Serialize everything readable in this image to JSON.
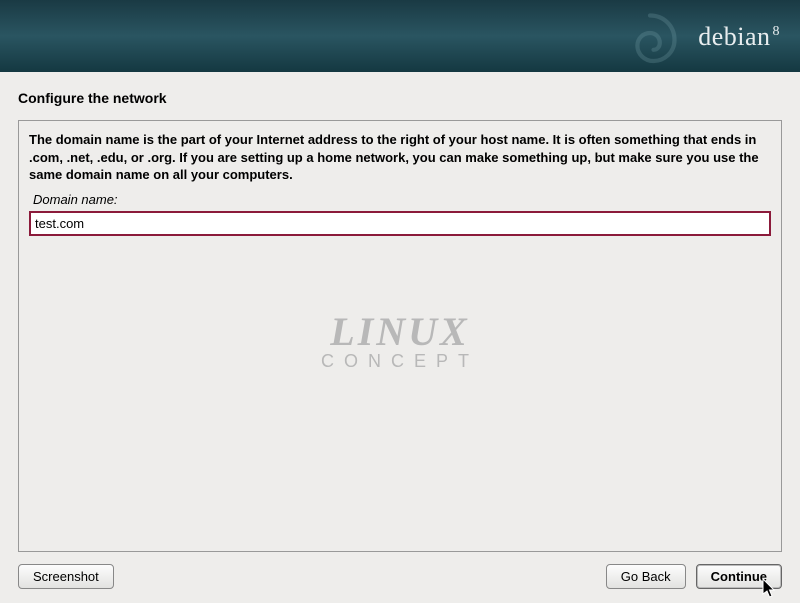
{
  "banner": {
    "brand": "debian",
    "version": "8"
  },
  "page": {
    "title": "Configure the network",
    "instructions": "The domain name is the part of your Internet address to the right of your host name.  It is often something that ends in .com, .net, .edu, or .org.  If you are setting up a home network, you can make something up, but make sure you use the same domain name on all your computers.",
    "field_label": "Domain name:",
    "domain_value": "test.com"
  },
  "watermark": {
    "line1": "LINUX",
    "line2": "CONCEPT"
  },
  "buttons": {
    "screenshot": "Screenshot",
    "go_back": "Go Back",
    "continue": "Continue"
  }
}
